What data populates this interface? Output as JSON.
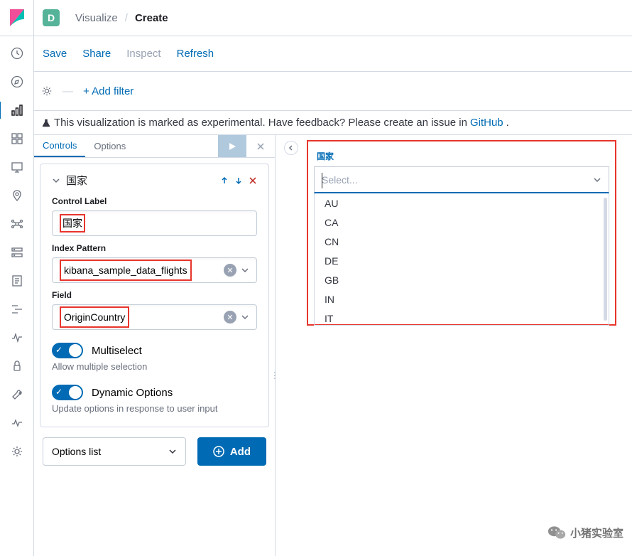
{
  "header": {
    "space_letter": "D",
    "breadcrumb_parent": "Visualize",
    "breadcrumb_current": "Create"
  },
  "actions": {
    "save": "Save",
    "share": "Share",
    "inspect": "Inspect",
    "refresh": "Refresh"
  },
  "filter": {
    "add_filter": "+ Add filter"
  },
  "banner": {
    "prefix": "This visualization is marked as experimental. Have feedback? Please create an issue in ",
    "link": "GitHub",
    "suffix": "."
  },
  "tabs": {
    "controls": "Controls",
    "options": "Options"
  },
  "panel": {
    "title": "国家",
    "control_label_label": "Control Label",
    "control_label_value": "国家",
    "index_pattern_label": "Index Pattern",
    "index_pattern_value": "kibana_sample_data_flights",
    "field_label": "Field",
    "field_value": "OriginCountry",
    "multiselect_label": "Multiselect",
    "multiselect_help": "Allow multiple selection",
    "dynamic_label": "Dynamic Options",
    "dynamic_help": "Update options in response to user input"
  },
  "bottom": {
    "type_value": "Options list",
    "add_button": "Add"
  },
  "preview": {
    "label": "国家",
    "placeholder": "Select...",
    "options": [
      "AU",
      "CA",
      "CN",
      "DE",
      "GB",
      "IN",
      "IT"
    ]
  },
  "watermark": "小猪实验室"
}
